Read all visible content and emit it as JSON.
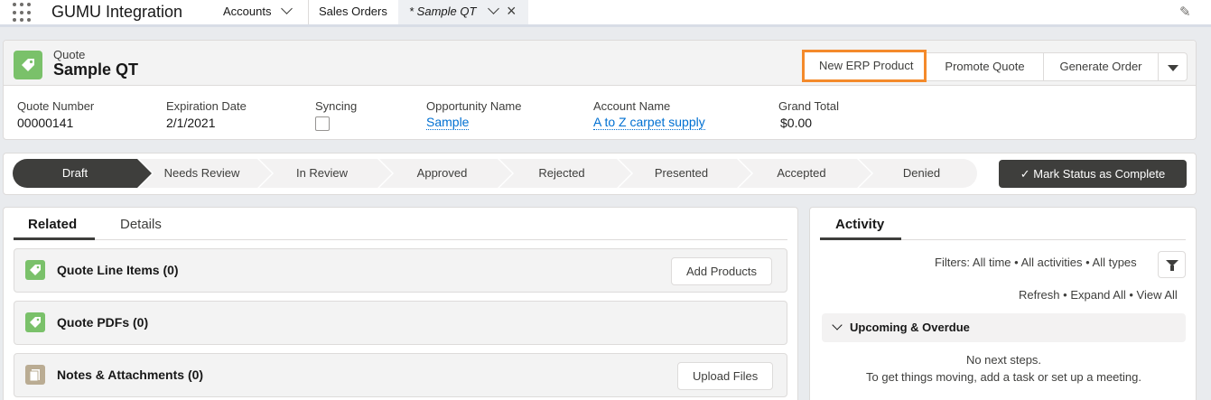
{
  "navbar": {
    "app_name": "GUMU Integration",
    "tabs": [
      {
        "label": "Accounts"
      },
      {
        "label": "Sales Orders"
      },
      {
        "label": "* Sample QT"
      }
    ]
  },
  "record": {
    "object_label": "Quote",
    "title": "Sample QT",
    "actions": {
      "new_erp": "New ERP Product",
      "promote": "Promote Quote",
      "generate": "Generate Order"
    },
    "fields": [
      {
        "label": "Quote Number",
        "value": "00000141"
      },
      {
        "label": "Expiration Date",
        "value": "2/1/2021"
      },
      {
        "label": "Syncing",
        "value": ""
      },
      {
        "label": "Opportunity Name",
        "value": "Sample"
      },
      {
        "label": "Account Name",
        "value": "A to Z carpet supply"
      },
      {
        "label": "Grand Total",
        "value": "$0.00"
      }
    ]
  },
  "path": {
    "stages": [
      "Draft",
      "Needs Review",
      "In Review",
      "Approved",
      "Rejected",
      "Presented",
      "Accepted",
      "Denied"
    ],
    "current": "Draft",
    "mark_button": "Mark Status as Complete"
  },
  "related": {
    "tabs": [
      "Related",
      "Details"
    ],
    "cards": [
      {
        "title": "Quote Line Items (0)",
        "button": "Add Products"
      },
      {
        "title": "Quote PDFs (0)",
        "button": ""
      },
      {
        "title": "Notes & Attachments (0)",
        "button": "Upload Files"
      }
    ]
  },
  "activity": {
    "tab": "Activity",
    "filters": "Filters: All time • All activities • All types",
    "links": [
      "Refresh",
      "Expand All",
      "View All"
    ],
    "upcoming": "Upcoming & Overdue",
    "empty_line1": "No next steps.",
    "empty_line2": "To get things moving, add a task or set up a meeting."
  },
  "colors": {
    "accent_orange": "#f48a2b",
    "quote_icon_green": "#7ac16a",
    "link_blue": "#0070d2",
    "path_current": "#3e3e3c"
  }
}
